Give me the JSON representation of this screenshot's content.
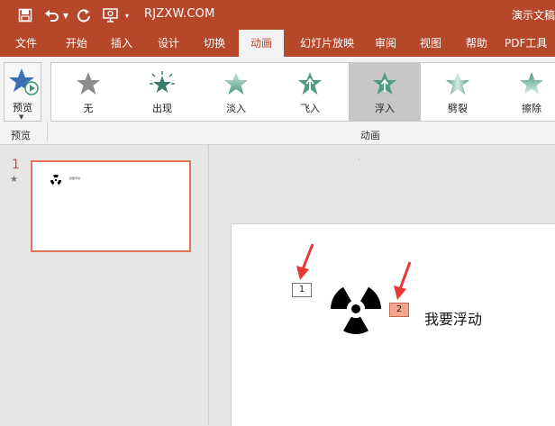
{
  "titlebar": {
    "site": "RJZXW.COM",
    "doc_title": "演示文稿",
    "background": "#b7472a"
  },
  "quick_access": [
    {
      "name": "save-icon"
    },
    {
      "name": "undo-icon"
    },
    {
      "name": "redo-icon"
    },
    {
      "name": "present-icon"
    }
  ],
  "tabs": [
    "文件",
    "开始",
    "插入",
    "设计",
    "切换",
    "动画",
    "幻灯片放映",
    "审阅",
    "视图",
    "帮助",
    "PDF工具"
  ],
  "active_tab": "动画",
  "ribbon": {
    "preview": {
      "label": "预览",
      "group": "预览"
    },
    "animation_group": "动画",
    "animations": [
      "无",
      "出现",
      "淡入",
      "飞入",
      "浮入",
      "劈裂",
      "擦除"
    ],
    "selected_animation": "浮入",
    "accent": "#5fa38f"
  },
  "slides_pane": {
    "number": "1",
    "star": "★",
    "thumb_text": "我要浮动"
  },
  "slide": {
    "tag1": "1",
    "tag2": "2",
    "text": "我要浮动",
    "arrow_color": "#e53935"
  }
}
